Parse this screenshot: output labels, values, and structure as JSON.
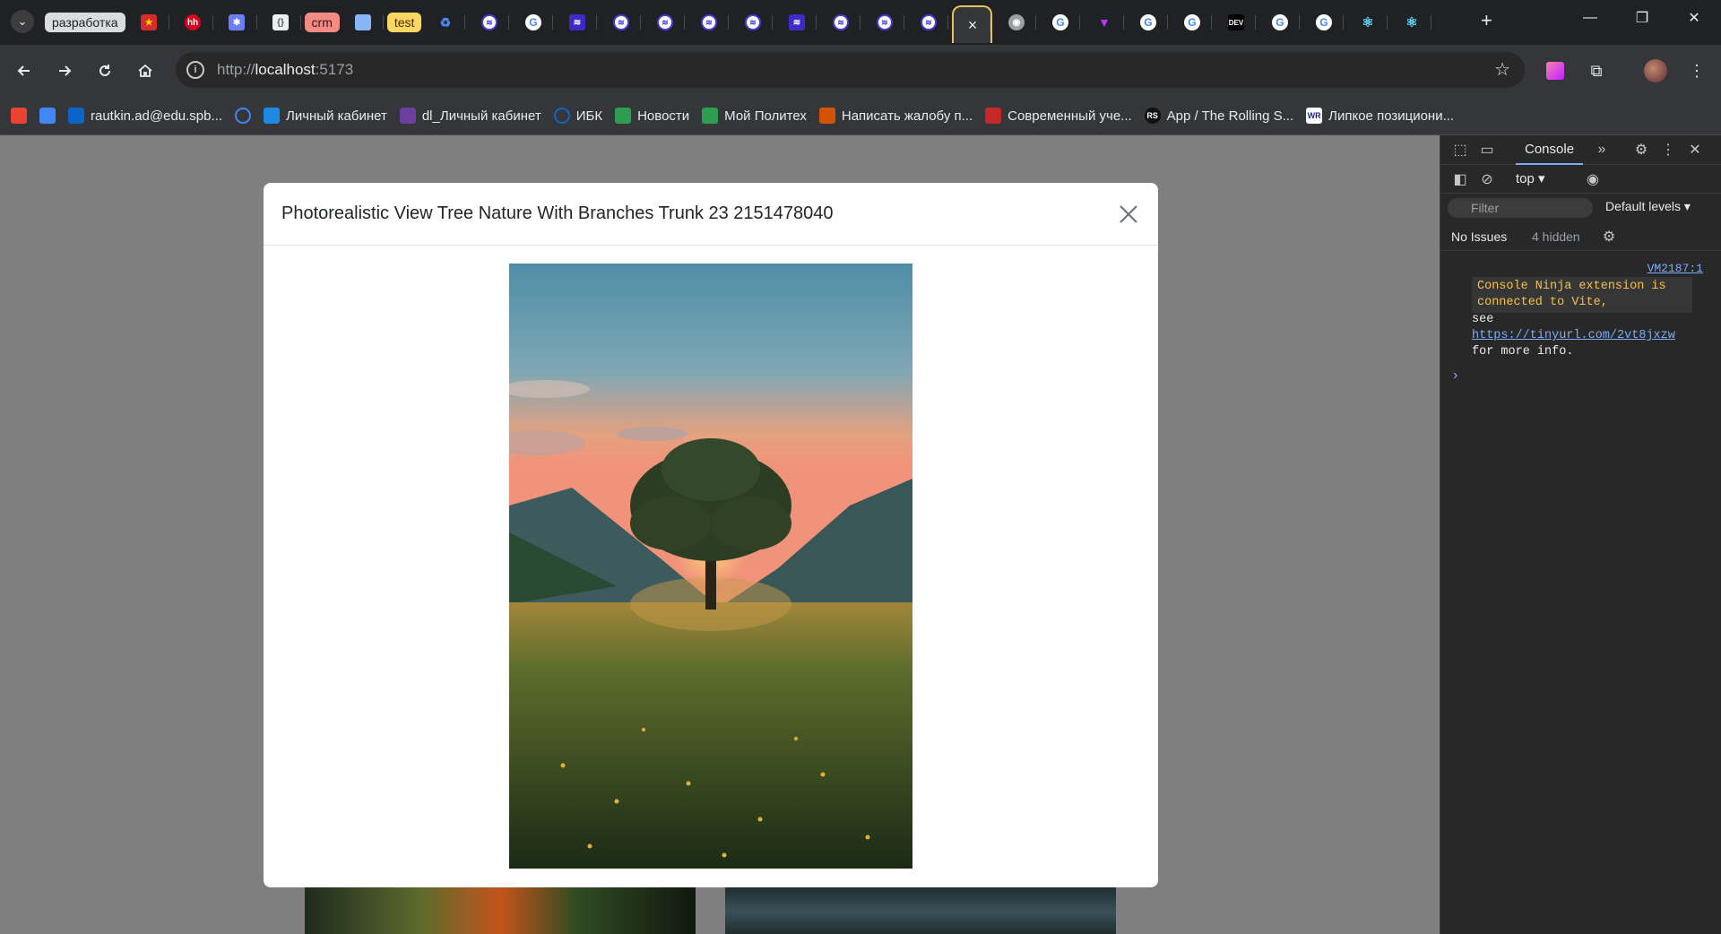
{
  "browser": {
    "tab_groups": [
      {
        "label": "разработка",
        "bg": "#dadce0",
        "fg": "#202124"
      },
      {
        "label": "crm",
        "bg": "#f28b82",
        "fg": "#3c1515"
      },
      {
        "label": "test",
        "bg": "#fdd663",
        "fg": "#3b2e00"
      }
    ],
    "active_tab_close": "×",
    "new_tab": "+",
    "window_controls": {
      "minimize": "—",
      "restore": "❐",
      "close": "✕"
    }
  },
  "toolbar": {
    "url_scheme": "http://",
    "url_host": "localhost",
    "url_port": ":5173"
  },
  "bookmarks": [
    {
      "label": "",
      "icon": "gmail-icon",
      "color": "#ea4335"
    },
    {
      "label": "",
      "icon": "gmail-m-icon",
      "color": "#4285f4"
    },
    {
      "label": "rautkin.ad@edu.spb...",
      "icon": "outlook-icon",
      "color": "#0a64c8"
    },
    {
      "label": "",
      "icon": "loader-icon",
      "color": "#4285f4"
    },
    {
      "label": "Личный кабинет",
      "icon": "polytech-icon",
      "color": "#1e88e5"
    },
    {
      "label": "dl_Личный кабинет",
      "icon": "dl-icon",
      "color": "#6a3fa0"
    },
    {
      "label": "ИБК",
      "icon": "ibk-icon",
      "color": "#1565c0"
    },
    {
      "label": "Новости",
      "icon": "news-icon",
      "color": "#2e9d4f"
    },
    {
      "label": "Мой Политех",
      "icon": "mypolytech-icon",
      "color": "#2e9d4f"
    },
    {
      "label": "Написать жалобу п...",
      "icon": "complaint-icon",
      "color": "#d35400"
    },
    {
      "label": "Современный уче...",
      "icon": "tutorial-icon",
      "color": "#c62828"
    },
    {
      "label": "App / The Rolling S...",
      "icon": "rs-icon",
      "color": "#111111"
    },
    {
      "label": "Липкое позициони...",
      "icon": "wr-icon",
      "color": "#ffffff"
    }
  ],
  "modal": {
    "title": "Photorealistic View Tree Nature With Branches Trunk 23 2151478040",
    "image_subject": "tree at sunset in a valley meadow"
  },
  "devtools": {
    "tab_console": "Console",
    "context": "top ▾",
    "filter_placeholder": "Filter",
    "levels": "Default levels ▾",
    "no_issues": "No Issues",
    "hidden": "4 hidden",
    "message_source": "VM2187:1",
    "ninja_text_1": "Console Ninja extension is",
    "ninja_text_2": "connected to Vite,",
    "line_see": "see",
    "line_link": "https://tinyurl.com/2vt8jxzw",
    "line_more": "for more info.",
    "prompt": "›"
  }
}
